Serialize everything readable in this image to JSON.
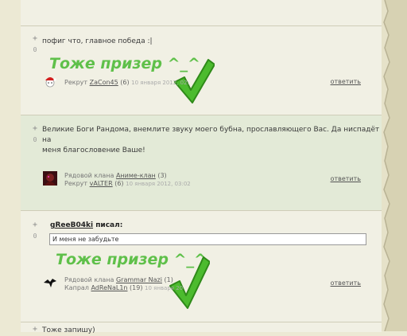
{
  "comments": [
    {
      "vote_plus": "+",
      "score": "0",
      "text": "пофиг что, главное победа :|",
      "overlay": "Тоже призер ^_^",
      "author_rank": "Рекрут",
      "author_name": "ZaCon45",
      "author_count": "(6)",
      "date": "10 января 2012, 02:",
      "reply": "ответить"
    },
    {
      "vote_plus": "+",
      "score": "0",
      "text_line1": "Великие Боги Рандома, внемлите звуку моего бубна, прославляющего Вас. Да ниспадёт на",
      "text_line2": "меня благословение Ваше!",
      "clan_rank": "Рядовой клана",
      "clan_name": "Аниме-клан",
      "clan_count": "(3)",
      "author_rank": "Рекрут",
      "author_name": "vALTER",
      "author_count": "(6)",
      "date": "10 января 2012, 03:02",
      "reply": "ответить"
    },
    {
      "vote_plus": "+",
      "score": "0",
      "quote_author": "gReeB04ki",
      "quote_suffix": "писал:",
      "quote_text": "И меня не забудьте",
      "overlay": "Тоже призер ^_^",
      "clan_rank": "Рядовой клана",
      "clan_name": "Grammar Nazi",
      "clan_count": "(1)",
      "author_rank": "Капрал",
      "author_name": "AdReNaL1n",
      "author_count": "(19)",
      "date": "10 января 20",
      "reply": "ответить"
    },
    {
      "vote_plus": "+",
      "text": "Тоже запишу)"
    }
  ],
  "colors": {
    "overlay_green": "#5fc04a",
    "alt_row": "#e3ead7",
    "plain_row": "#f1f0e4"
  }
}
